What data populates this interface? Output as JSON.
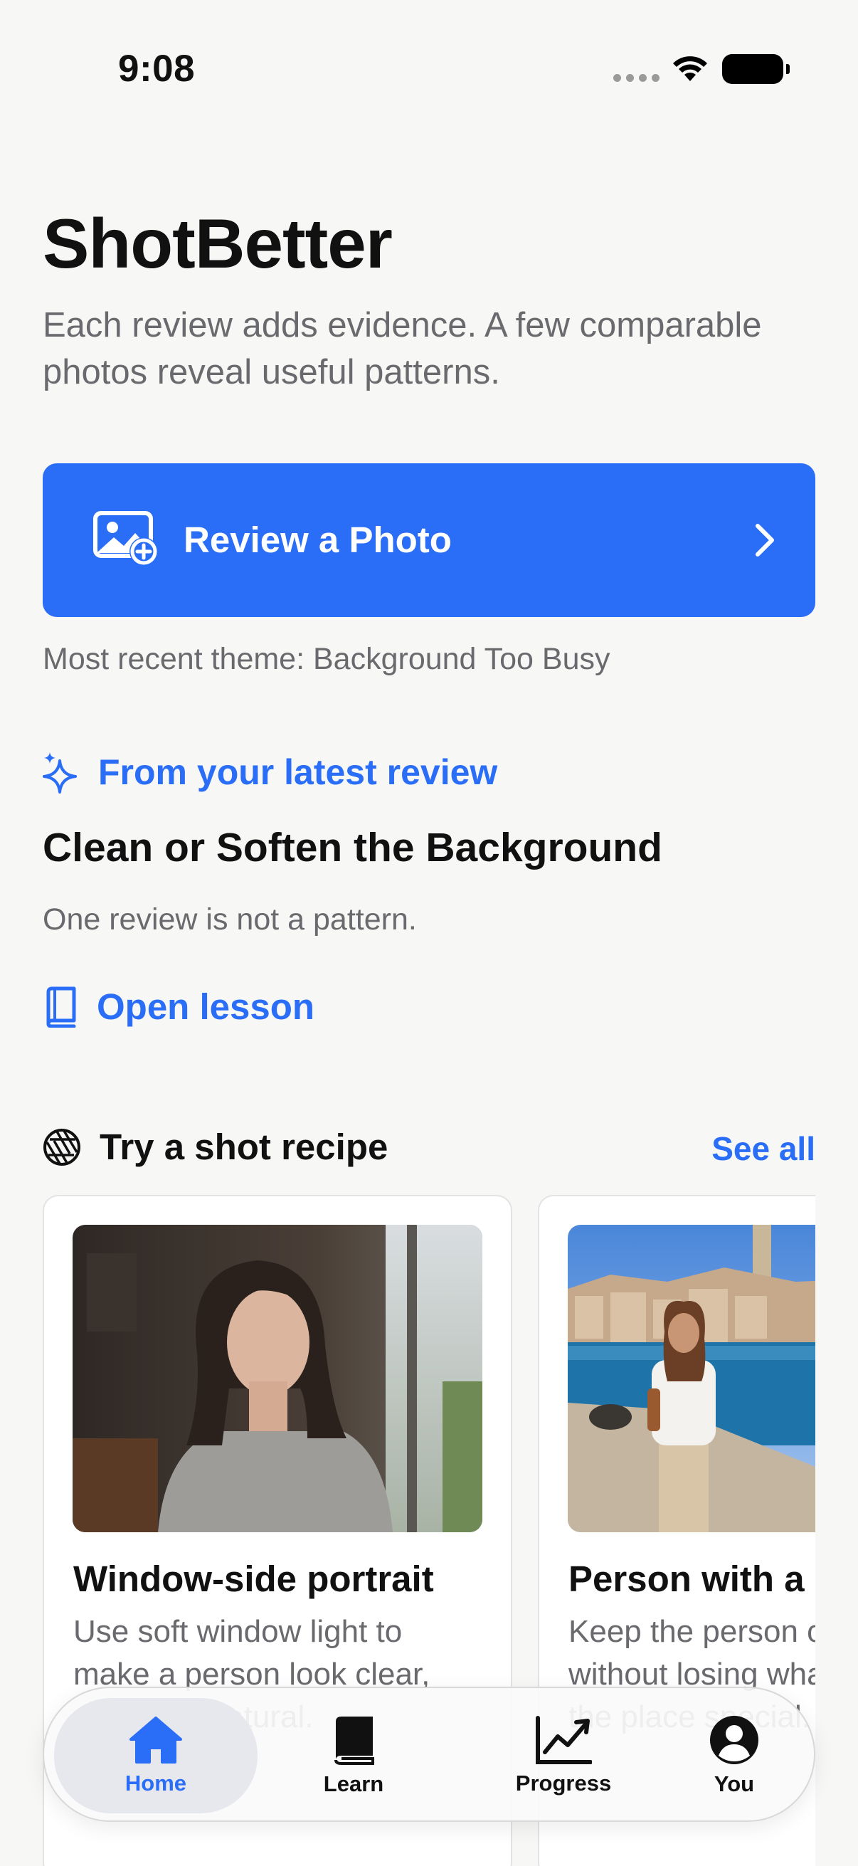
{
  "status": {
    "time": "9:08"
  },
  "header": {
    "title": "ShotBetter",
    "subtitle": "Each review adds evidence. A few comparable photos reveal useful patterns."
  },
  "review_button": {
    "label": "Review a Photo"
  },
  "recent_theme": "Most recent theme: Background Too Busy",
  "latest_review": {
    "label": "From your latest review",
    "lesson_title": "Clean or Soften the Background",
    "note": "One review is not a pattern.",
    "open_label": "Open lesson"
  },
  "recipes": {
    "header": "Try a shot recipe",
    "see_all": "See all",
    "cards": [
      {
        "title": "Window-side portrait",
        "description": "Use soft window light to make a person look clear, calm and natural."
      },
      {
        "title": "Person with a landmark",
        "description": "Keep the person clear without losing what makes the place special."
      }
    ]
  },
  "tabbar": {
    "tabs": [
      {
        "label": "Home",
        "active": true
      },
      {
        "label": "Learn",
        "active": false
      },
      {
        "label": "Progress",
        "active": false
      },
      {
        "label": "You",
        "active": false
      }
    ]
  },
  "colors": {
    "accent": "#2a6df6",
    "background": "#f7f7f5",
    "secondary_text": "#6a6a6e"
  }
}
